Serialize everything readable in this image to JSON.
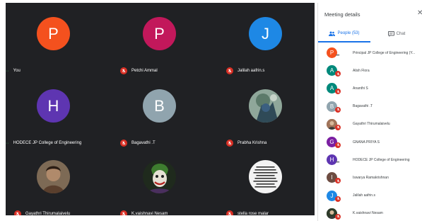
{
  "meeting_grid": {
    "tiles": [
      {
        "name": "You",
        "initial": "P",
        "color": "#f4511e",
        "muted": false,
        "kind": "letter"
      },
      {
        "name": "Petchi Ammal",
        "initial": "P",
        "color": "#c2185b",
        "muted": true,
        "kind": "letter"
      },
      {
        "name": "Jalilah aafrin.s",
        "initial": "J",
        "color": "#1e88e5",
        "muted": true,
        "kind": "letter"
      },
      {
        "name": "HODECE JP College of Engineering",
        "initial": "H",
        "color": "#5e35b1",
        "muted": false,
        "kind": "letter"
      },
      {
        "name": "Bagavathi .T",
        "initial": "B",
        "color": "#90a4ae",
        "muted": true,
        "kind": "letter"
      },
      {
        "name": "Prabha Krishna",
        "initial": "",
        "color": "#6d7f73",
        "muted": true,
        "kind": "photo-nature"
      },
      {
        "name": "Gayathri Thirumalaivelu",
        "initial": "",
        "color": "#a0745a",
        "muted": true,
        "kind": "photo-portrait"
      },
      {
        "name": "K.vaishnavi Nesam",
        "initial": "",
        "color": "#2e3b2a",
        "muted": true,
        "kind": "photo-joker"
      },
      {
        "name": "stella rose malar",
        "initial": "",
        "color": "#f1f1f1",
        "muted": true,
        "kind": "photo-text"
      }
    ]
  },
  "panel": {
    "title": "Meeting details",
    "close_icon": "close-icon",
    "tabs": {
      "people": "People (53)",
      "chat": "Chat"
    },
    "accent": "#1a73e8",
    "people": [
      {
        "name": "Principal JP College of Engineering (Y...",
        "initial": "P",
        "color": "#f4511e",
        "status": "dots"
      },
      {
        "name": "Alish Flora",
        "initial": "A",
        "color": "#00897b",
        "status": "muted"
      },
      {
        "name": "Ananthi S",
        "initial": "A",
        "color": "#00897b",
        "status": "muted"
      },
      {
        "name": "Bagavathi .T",
        "initial": "B",
        "color": "#90a4ae",
        "status": "muted"
      },
      {
        "name": "Gayathri Thirumalaivelu",
        "initial": "",
        "color": "#a0745a",
        "status": "muted"
      },
      {
        "name": "GNANA PRIYA S",
        "initial": "G",
        "color": "#7b1fa2",
        "status": "muted"
      },
      {
        "name": "HODECE JP College of Engineering",
        "initial": "H",
        "color": "#5e35b1",
        "status": "dots"
      },
      {
        "name": "Iswarya Ramakrishnan",
        "initial": "I",
        "color": "#6d4c41",
        "status": "muted"
      },
      {
        "name": "Jalilah aafrin.s",
        "initial": "J",
        "color": "#1e88e5",
        "status": "muted"
      },
      {
        "name": "K.vaishnavi Nesam",
        "initial": "",
        "color": "#2e3b2a",
        "status": "muted"
      }
    ]
  }
}
